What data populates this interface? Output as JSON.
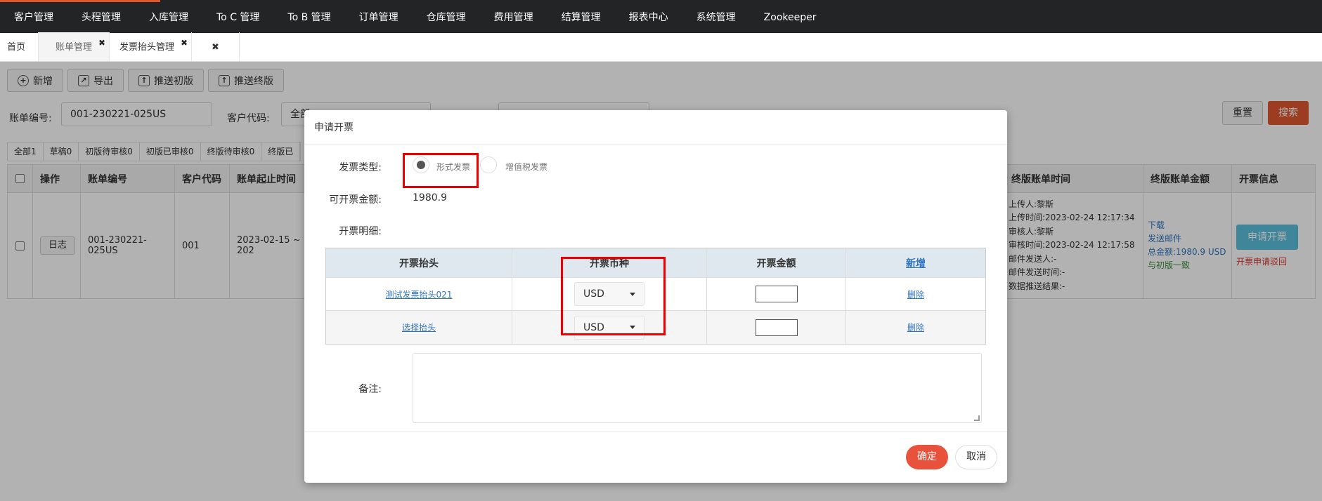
{
  "topnav": {
    "items": [
      "客户管理",
      "头程管理",
      "入库管理",
      "To C 管理",
      "To B 管理",
      "订单管理",
      "仓库管理",
      "费用管理",
      "结算管理",
      "报表中心",
      "系统管理",
      "Zookeeper"
    ],
    "accent_color": "#e0562f"
  },
  "tabs": {
    "items": [
      {
        "label": "首页"
      },
      {
        "label": "账单管理",
        "close_glyph": "✖"
      },
      {
        "label": "发票抬头管理",
        "close_glyph": "✖"
      }
    ],
    "close_all_glyph": "✖"
  },
  "toolbar": {
    "add_label": "新增",
    "export_label": "导出",
    "push_initial_label": "推送初版",
    "push_final_label": "推送终版"
  },
  "filter": {
    "bill_no_label": "账单编号:",
    "bill_no_value": "001-230221-025US",
    "customer_code_label": "客户代码:",
    "customer_code_value": "全部",
    "reset_label": "重置",
    "search_label": "搜索"
  },
  "status_tabs": [
    "全部1",
    "草稿0",
    "初版待审核0",
    "初版已审核0",
    "终版待审核0",
    "终版已"
  ],
  "grid": {
    "headers": {
      "op": "操作",
      "bill_no": "账单编号",
      "customer_code": "客户代码",
      "period": "账单起止时间",
      "final_time": "终版账单时间",
      "final_amount": "终版账单金额",
      "invoice_info": "开票信息"
    },
    "row": {
      "log_label": "日志",
      "bill_no": "001-230221-025US",
      "customer_code": "001",
      "period": "2023-02-15 ~ 202",
      "final_time_lines": [
        "上传人:黎斯",
        "上传时间:2023-02-24 12:17:34",
        "审核人:黎斯",
        "审核时间:2023-02-24 12:17:58",
        "邮件发送人:-",
        "邮件发送时间:-",
        "数据推送结果:-"
      ],
      "download_label": "下载",
      "send_mail_label": "发送邮件",
      "total_amount": "总金额:1980.9 USD",
      "match_label": "与初版一致",
      "apply_invoice_label": "申请开票",
      "reject_label": "开票申请驳回"
    }
  },
  "modal": {
    "title": "申请开票",
    "invoice_type_label": "发票类型:",
    "option_proforma": "形式发票",
    "option_vat": "增值税发票",
    "available_amount_label": "可开票金额:",
    "available_amount": "1980.9",
    "detail_label": "开票明细:",
    "table": {
      "headers": {
        "title": "开票抬头",
        "currency": "开票币种",
        "amount": "开票金额",
        "add": "新增"
      },
      "rows": [
        {
          "title": "测试发票抬头021",
          "currency": "USD",
          "delete": "删除"
        },
        {
          "title": "选择抬头",
          "currency": "USD",
          "delete": "删除"
        }
      ]
    },
    "remark_label": "备注:",
    "ok_label": "确定",
    "cancel_label": "取消"
  }
}
